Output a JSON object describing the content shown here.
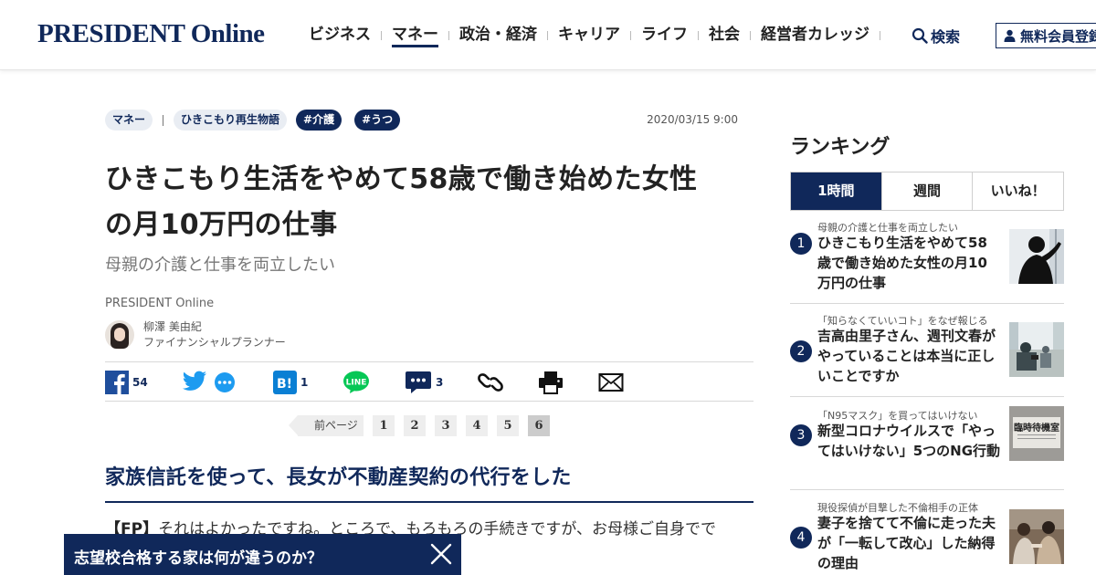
{
  "header": {
    "logo": "PRESIDENT Online",
    "nav": [
      {
        "label": "ビジネス"
      },
      {
        "label": "マネー",
        "active": true
      },
      {
        "label": "政治・経済"
      },
      {
        "label": "キャリア"
      },
      {
        "label": "ライフ"
      },
      {
        "label": "社会"
      },
      {
        "label": "経営者カレッジ"
      }
    ],
    "search_label": "検索",
    "member_label": "無料会員登録"
  },
  "article": {
    "tags": [
      "マネー",
      "ひきこもり再生物語",
      "#介護",
      "#うつ"
    ],
    "date": "2020/03/15 9:00",
    "title_line1": "ひきこもり生活をやめて58歳で働き始めた女性",
    "title_line2": "の月10万円の仕事",
    "subtitle": "母親の介護と仕事を両立したい",
    "source": "PRESIDENT Online",
    "author_name": "柳澤 美由紀",
    "author_role": "ファイナンシャルプランナー",
    "share": {
      "facebook_count": "54",
      "hatena_count": "1",
      "comment_count": "3"
    },
    "pager": {
      "prev_label": "前ページ",
      "pages": [
        "1",
        "2",
        "3",
        "4",
        "5",
        "6"
      ],
      "current": "6"
    },
    "section_heading": "家族信託を使って、長女が不動産契約の代行をした",
    "body_speaker": "【FP】",
    "body_text": "それはよかったですね。ところで、もろもろの手続きですが、お母様ご自身でで"
  },
  "ranking": {
    "title": "ランキング",
    "tabs": [
      "1時間",
      "週間",
      "いいね！"
    ],
    "active_tab": "1時間",
    "items": [
      {
        "rank": "1",
        "category": "母親の介護と仕事を両立したい",
        "headline": "ひきこもり生活をやめて58歳で働き始めた女性の月10万円の仕事"
      },
      {
        "rank": "2",
        "category": "「知らなくていいコト」をなぜ報じる",
        "headline": "吉高由里子さん、週刊文春がやっていることは本当に正しいことですか"
      },
      {
        "rank": "3",
        "category": "「N95マスク」を買ってはいけない",
        "headline": "新型コロナウイルスで「やってはいけない」5つのNG行動"
      },
      {
        "rank": "4",
        "category": "現役探偵が目撃した不倫相手の正体",
        "headline": "妻子を捨てて不倫に走った夫が「一転して改心」した納得の理由"
      }
    ],
    "thumb3_text": "臨時待機室"
  },
  "banner": {
    "text": "志望校合格する家は何が違うのか？"
  },
  "colors": {
    "brand": "#10285a",
    "tag_light": "#e9edf3"
  }
}
